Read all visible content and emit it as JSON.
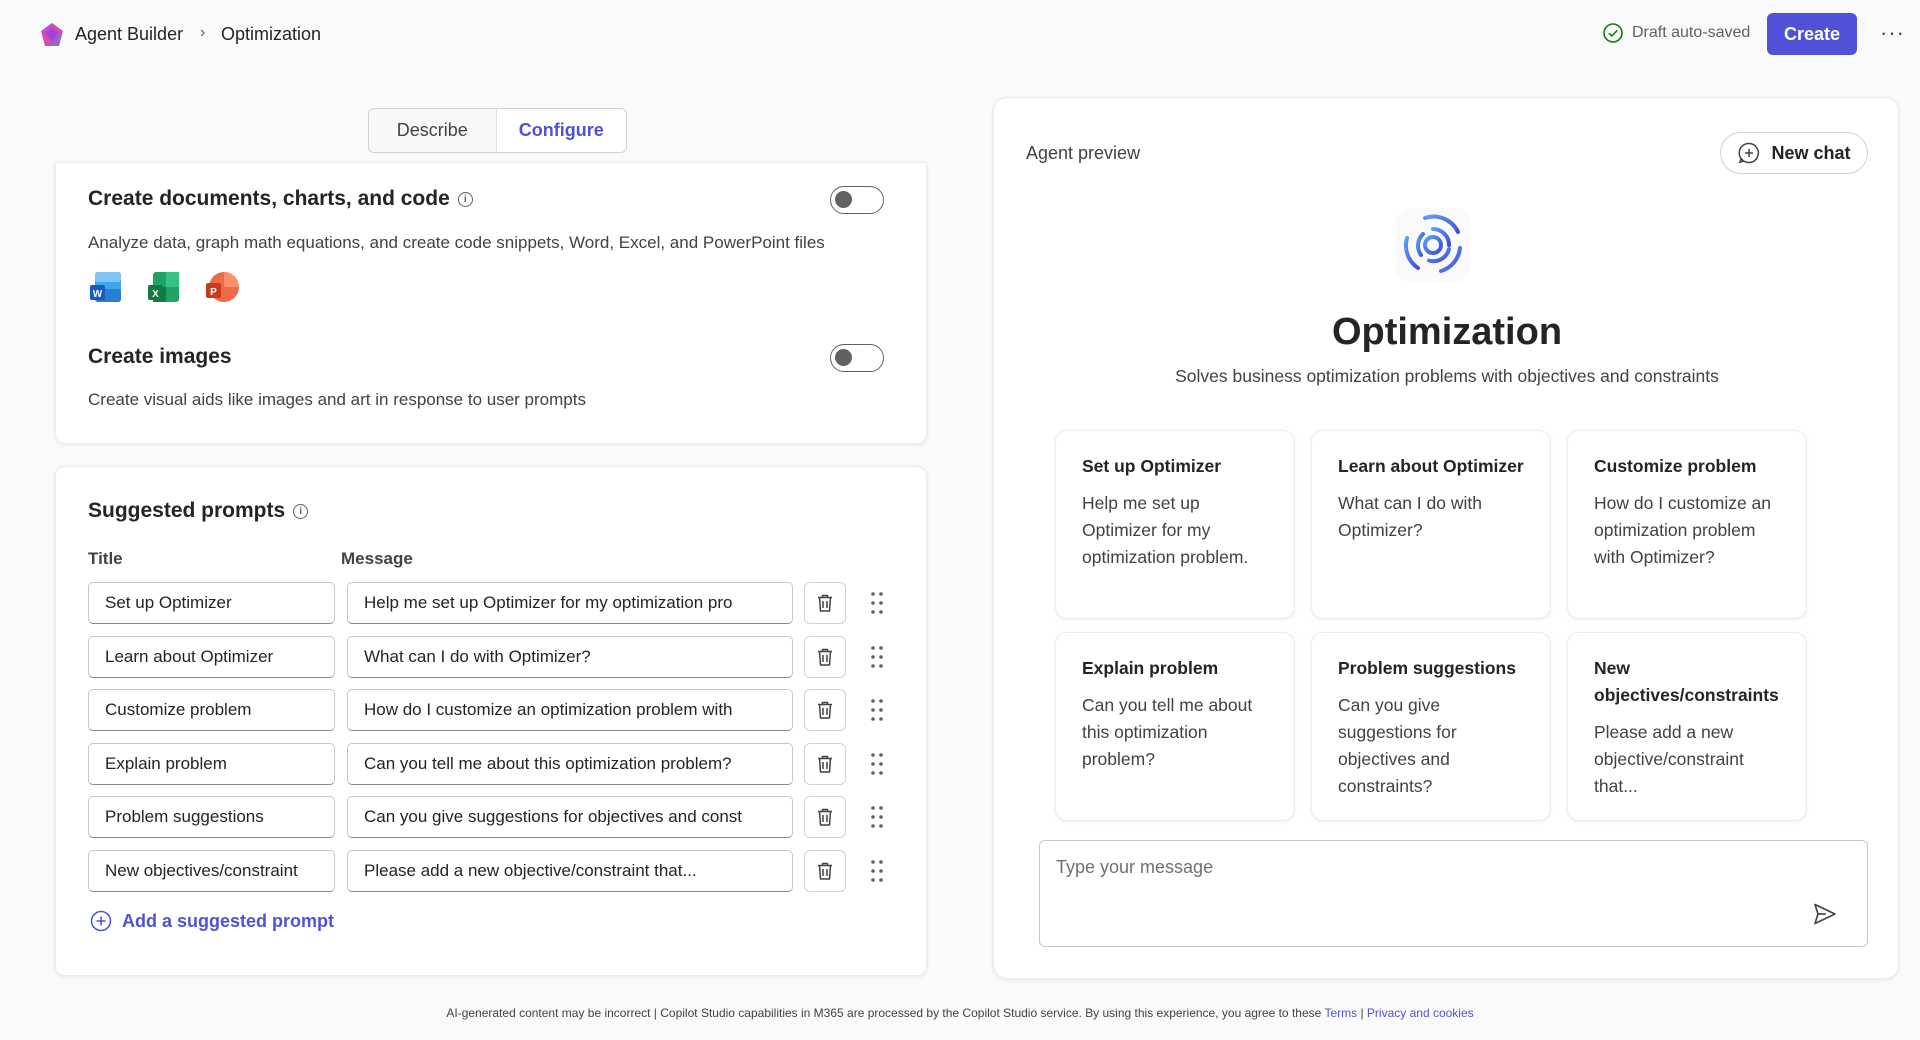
{
  "header": {
    "app_name": "Agent Builder",
    "breadcrumb_sep": "›",
    "page": "Optimization",
    "save_status": "Draft auto-saved",
    "create_label": "Create",
    "more_label": "···"
  },
  "tabs": [
    {
      "label": "Describe",
      "selected": false
    },
    {
      "label": "Configure",
      "selected": true
    }
  ],
  "capabilities": {
    "code": {
      "title": "Create documents, charts, and code",
      "info": "i",
      "description": "Analyze data, graph math equations, and create code snippets, Word, Excel, and PowerPoint files",
      "enabled": false,
      "apps": [
        "word-icon",
        "excel-icon",
        "powerpoint-icon"
      ]
    },
    "images": {
      "title": "Create images",
      "description": "Create visual aids like images and art in response to user prompts",
      "enabled": false
    }
  },
  "suggested_prompts": {
    "title": "Suggested prompts",
    "info": "i",
    "col_title": "Title",
    "col_message": "Message",
    "rows": [
      {
        "title": "Set up Optimizer",
        "message": "Help me set up Optimizer for my optimization pro"
      },
      {
        "title": "Learn about Optimizer",
        "message": "What can I do with Optimizer?"
      },
      {
        "title": "Customize problem",
        "message": "How do I customize an optimization problem with"
      },
      {
        "title": "Explain problem",
        "message": "Can you tell me about this optimization problem?"
      },
      {
        "title": "Problem suggestions",
        "message": "Can you give suggestions for objectives and const"
      },
      {
        "title": "New objectives/constraint",
        "message": "Please add a new objective/constraint that..."
      }
    ],
    "add_label": "Add a suggested prompt"
  },
  "preview": {
    "label": "Agent preview",
    "new_chat_label": "New chat",
    "agent_name": "Optimization",
    "agent_description": "Solves business optimization problems with objectives and constraints",
    "cards": [
      {
        "title": "Set up Optimizer",
        "body": "Help me set up Optimizer for my optimization problem."
      },
      {
        "title": "Learn about Optimizer",
        "body": "What can I do with Optimizer?"
      },
      {
        "title": "Customize problem",
        "body": "How do I customize an optimization problem with Optimizer?"
      },
      {
        "title": "Explain problem",
        "body": "Can you tell me about this optimization problem?"
      },
      {
        "title": "Problem suggestions",
        "body": "Can you give suggestions for objectives and constraints?"
      },
      {
        "title": "New objectives/constraints",
        "body": "Please add a new objective/constraint that..."
      }
    ],
    "input_placeholder": "Type your message"
  },
  "footer": {
    "text": "AI-generated content may be incorrect | Copilot Studio capabilities in M365 are processed by the Copilot Studio service. By using this experience, you agree to these",
    "terms": "Terms",
    "sep": "|",
    "privacy": "Privacy and cookies"
  },
  "colors": {
    "accent": "#4f52d6",
    "success": "#107c10"
  }
}
